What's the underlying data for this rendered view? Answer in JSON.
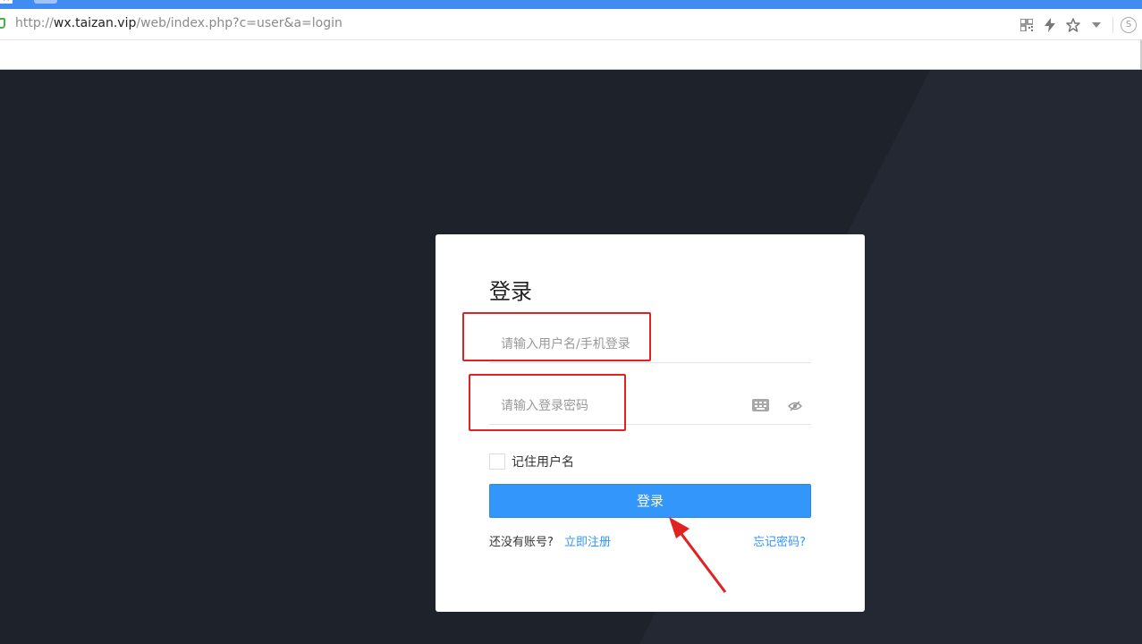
{
  "browser": {
    "url_prefix": "http://",
    "url_host": "wx.taizan.vip",
    "url_path": "/web/index.php?c=user&a=login",
    "tab_close_glyph": "×",
    "icons": [
      "qr-code-icon",
      "lightning-icon",
      "star-icon",
      "dropdown-icon",
      "s-logo-icon"
    ],
    "s_logo_glyph": "S"
  },
  "login": {
    "title": "登录",
    "username_placeholder": "请输入用户名/手机登录",
    "password_placeholder": "请输入登录密码",
    "remember_label": "记住用户名",
    "submit_label": "登录",
    "no_account_text": "还没有账号?",
    "register_link": "立即注册",
    "forgot_link": "忘记密码?"
  },
  "colors": {
    "page_background": "#1e222b",
    "primary_button": "#3296fa",
    "link": "#3296fa",
    "annotation": "#e02222",
    "browser_tabstrip": "#3f8cf3"
  }
}
